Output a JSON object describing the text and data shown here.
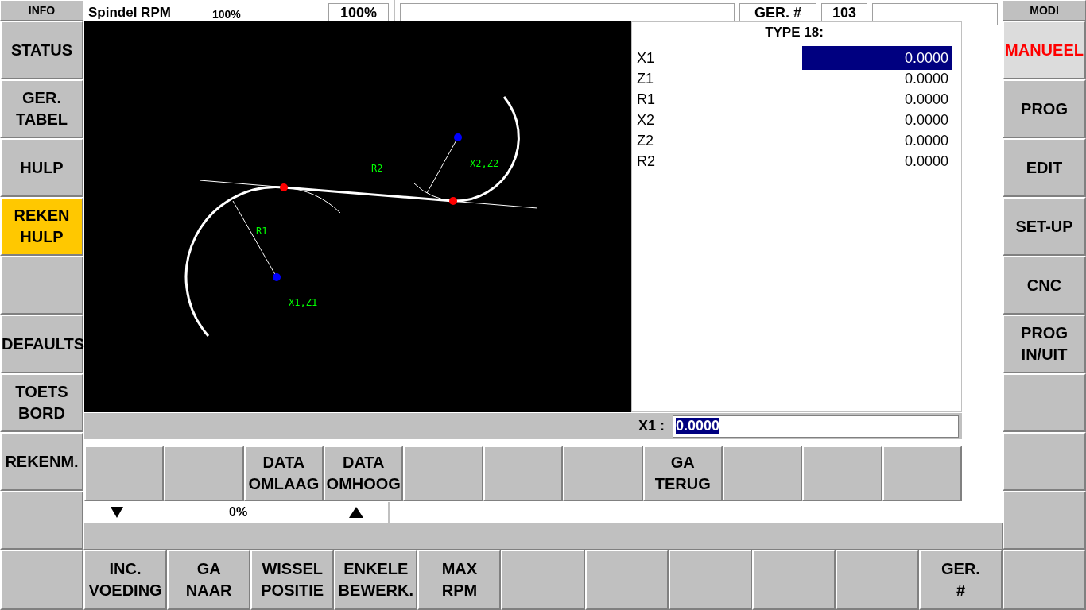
{
  "left_panel": {
    "header": "INFO",
    "buttons": [
      {
        "lines": [
          "STATUS"
        ],
        "selected": false
      },
      {
        "lines": [
          "GER.",
          "TABEL"
        ],
        "selected": false
      },
      {
        "lines": [
          "HULP"
        ],
        "selected": false
      },
      {
        "lines": [
          "REKEN",
          "HULP"
        ],
        "selected": true
      },
      {
        "selected": false
      },
      {
        "lines": [
          "DEFAULTS"
        ],
        "selected": false
      },
      {
        "lines": [
          "TOETS",
          "BORD"
        ],
        "selected": false
      },
      {
        "lines": [
          "REKENM."
        ],
        "selected": false
      },
      {
        "selected": false
      }
    ]
  },
  "right_panel": {
    "header": "MODI",
    "buttons": [
      {
        "lines": [
          "MANUEEL"
        ],
        "selected": true
      },
      {
        "lines": [
          "PROG"
        ],
        "selected": false
      },
      {
        "lines": [
          "EDIT"
        ],
        "selected": false
      },
      {
        "lines": [
          "SET-UP"
        ],
        "selected": false
      },
      {
        "lines": [
          "CNC"
        ],
        "selected": false
      },
      {
        "lines": [
          "PROG",
          "IN/UIT"
        ],
        "selected": false
      },
      {
        "selected": false
      },
      {
        "selected": false
      },
      {
        "selected": false
      }
    ]
  },
  "top_bar": {
    "spindle_label": "Spindel RPM",
    "spindle_percent": "100%",
    "override": "100%",
    "tool_label": "GER. #",
    "tool_number": "103"
  },
  "feed_row": {
    "percent": "0%"
  },
  "dialog": {
    "title": "TYPE 18:",
    "params": [
      {
        "name": "X1",
        "value": "0.0000",
        "selected": true
      },
      {
        "name": "Z1",
        "value": "0.0000",
        "selected": false
      },
      {
        "name": "R1",
        "value": "0.0000",
        "selected": false
      },
      {
        "name": "X2",
        "value": "0.0000",
        "selected": false
      },
      {
        "name": "Z2",
        "value": "0.0000",
        "selected": false
      },
      {
        "name": "R2",
        "value": "0.0000",
        "selected": false
      }
    ],
    "drawing_labels": {
      "r1": "R1",
      "r2": "R2",
      "center1": "X1,Z1",
      "center2": "X2,Z2"
    },
    "input": {
      "label": "X1 :",
      "value": "0.0000"
    },
    "softkeys": [
      {
        "kind": "blank"
      },
      {
        "kind": "blank"
      },
      {
        "kind": "label",
        "lines": [
          "DATA",
          "OMLAAG"
        ]
      },
      {
        "kind": "label",
        "lines": [
          "DATA",
          "OMHOOG"
        ]
      },
      {
        "kind": "blank"
      },
      {
        "kind": "blank"
      },
      {
        "kind": "blank"
      },
      {
        "kind": "label",
        "lines": [
          "GA",
          "TERUG"
        ]
      },
      {
        "kind": "blank"
      },
      {
        "kind": "blank"
      },
      {
        "kind": "blank"
      }
    ]
  },
  "bottom_softkeys": [
    {
      "kind": "label",
      "lines": [
        "INC.",
        "VOEDING"
      ]
    },
    {
      "kind": "label",
      "lines": [
        "GA",
        "NAAR"
      ]
    },
    {
      "kind": "label",
      "lines": [
        "WISSEL",
        "POSITIE"
      ]
    },
    {
      "kind": "label",
      "lines": [
        "ENKELE",
        "BEWERK."
      ]
    },
    {
      "kind": "label",
      "lines": [
        "MAX",
        "RPM"
      ]
    },
    {
      "kind": "blank"
    },
    {
      "kind": "blank"
    },
    {
      "kind": "blank"
    },
    {
      "kind": "blank"
    },
    {
      "kind": "blank"
    },
    {
      "kind": "label",
      "lines": [
        "GER.",
        "#"
      ]
    }
  ]
}
